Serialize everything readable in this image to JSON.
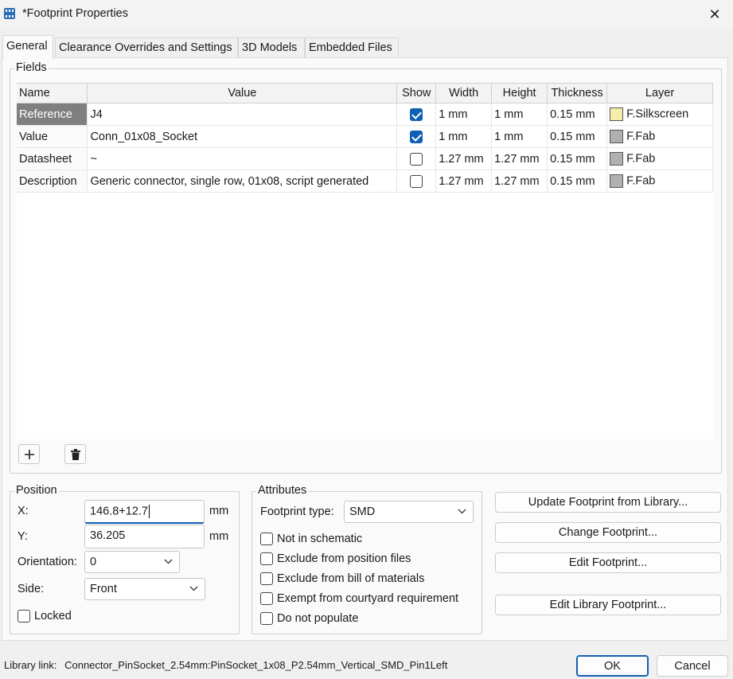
{
  "window": {
    "title": "*Footprint Properties",
    "close_glyph": "✕"
  },
  "tabs": [
    {
      "label": "General"
    },
    {
      "label": "Clearance Overrides and Settings"
    },
    {
      "label": "3D Models"
    },
    {
      "label": "Embedded Files"
    }
  ],
  "fields_group": {
    "label": "Fields"
  },
  "table": {
    "headers": [
      "Name",
      "Value",
      "Show",
      "Width",
      "Height",
      "Thickness",
      "Layer"
    ],
    "rows": [
      {
        "name": "Reference",
        "value": "J4",
        "show": true,
        "width": "1 mm",
        "height": "1 mm",
        "thickness": "0.15 mm",
        "layer": "F.Silkscreen",
        "layer_color": "#f5eeaa"
      },
      {
        "name": "Value",
        "value": "Conn_01x08_Socket",
        "show": true,
        "width": "1 mm",
        "height": "1 mm",
        "thickness": "0.15 mm",
        "layer": "F.Fab",
        "layer_color": "#b0b0b0"
      },
      {
        "name": "Datasheet",
        "value": "~",
        "show": false,
        "width": "1.27 mm",
        "height": "1.27 mm",
        "thickness": "0.15 mm",
        "layer": "F.Fab",
        "layer_color": "#b0b0b0"
      },
      {
        "name": "Description",
        "value": "Generic connector, single row, 01x08, script generated",
        "show": false,
        "width": "1.27 mm",
        "height": "1.27 mm",
        "thickness": "0.15 mm",
        "layer": "F.Fab",
        "layer_color": "#b0b0b0"
      }
    ]
  },
  "position": {
    "label": "Position",
    "x_label": "X:",
    "x_value": "146.8+12.7",
    "x_unit": "mm",
    "y_label": "Y:",
    "y_value": "36.205",
    "y_unit": "mm",
    "orientation_label": "Orientation:",
    "orientation_value": "0",
    "side_label": "Side:",
    "side_value": "Front",
    "locked_label": "Locked"
  },
  "attributes": {
    "label": "Attributes",
    "type_label": "Footprint type:",
    "type_value": "SMD",
    "checks": [
      "Not in schematic",
      "Exclude from position files",
      "Exclude from bill of materials",
      "Exempt from courtyard requirement",
      "Do not populate"
    ]
  },
  "actions": {
    "update": "Update Footprint from Library...",
    "change": "Change Footprint...",
    "edit": "Edit Footprint...",
    "edit_library": "Edit Library Footprint..."
  },
  "footer": {
    "library_link_label": "Library link:",
    "library_link_value": "Connector_PinSocket_2.54mm:PinSocket_1x08_P2.54mm_Vertical_SMD_Pin1Left",
    "ok": "OK",
    "cancel": "Cancel"
  },
  "colors": {
    "accent": "#0f5fb4",
    "selected_row": "#7f7f7f"
  }
}
